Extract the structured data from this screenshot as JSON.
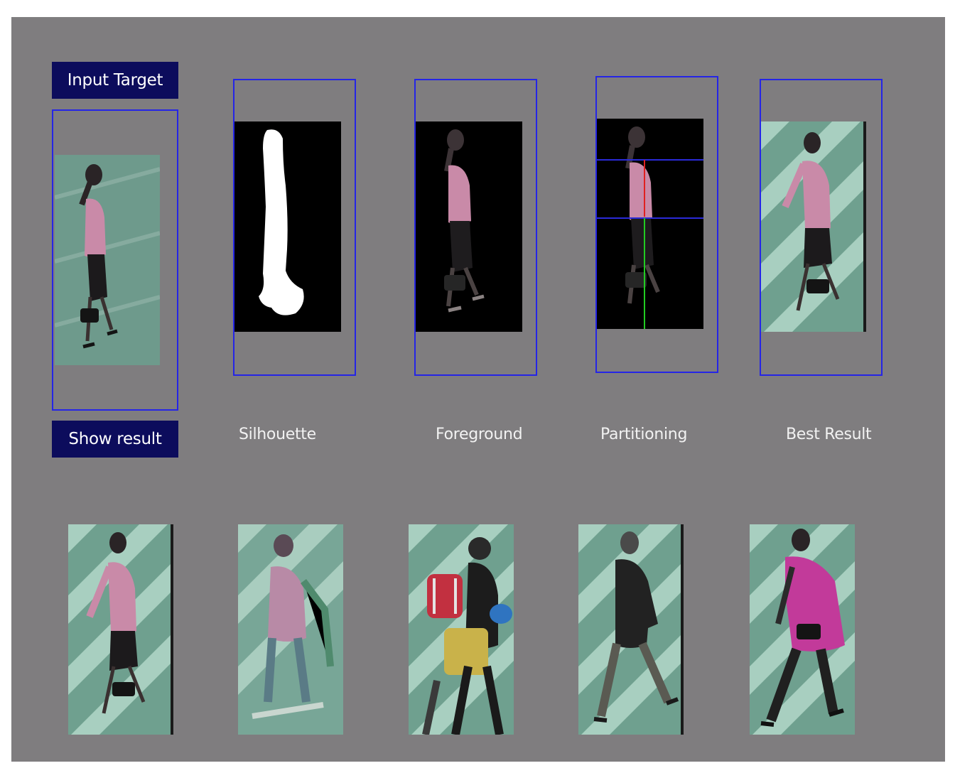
{
  "buttons": {
    "input_target": "Input Target",
    "show_result": "Show result"
  },
  "labels": {
    "silhouette": "Silhouette",
    "foreground": "Foreground",
    "partitioning": "Partitioning",
    "best_result": "Best Result"
  },
  "gallery": {
    "count": 5
  },
  "colors": {
    "panel": "#7f7d7f",
    "button": "#0c0c5c",
    "frame": "#2525e6",
    "torso_line": "#e02020",
    "legs_line": "#22cc22"
  }
}
